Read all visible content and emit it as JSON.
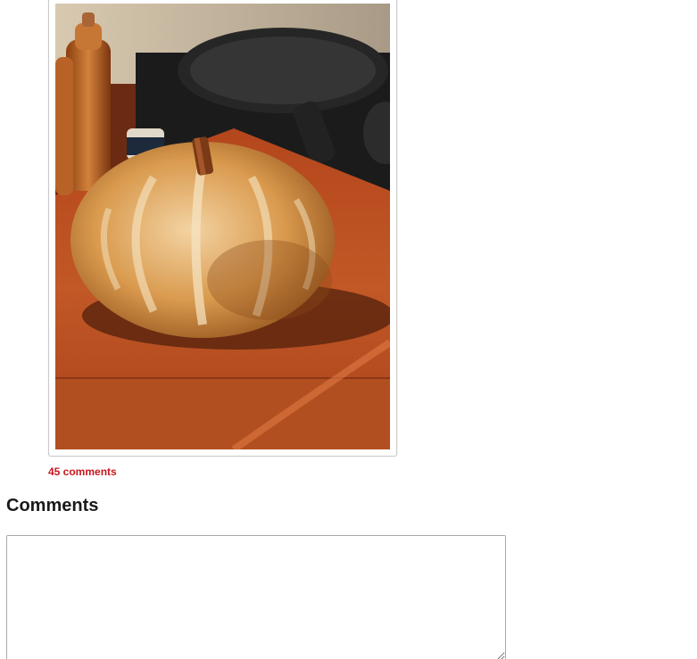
{
  "post": {
    "image_alt": "Pumpkin-shaped sourdough loaf on a wooden cutting board"
  },
  "comments_link": {
    "label": "45 comments"
  },
  "comments_section": {
    "title": "Comments",
    "input_value": "",
    "input_placeholder": ""
  },
  "colors": {
    "link": "#c8171e",
    "heading": "#1a1a1a",
    "border": "#c9c9c9"
  }
}
